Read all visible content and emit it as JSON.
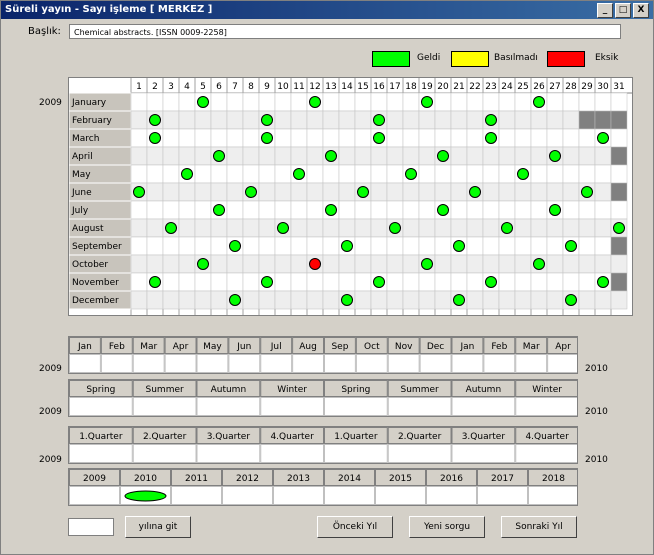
{
  "window": {
    "title": "Süreli yayın - Sayı işleme [ MERKEZ ]",
    "minimize_label": "_",
    "maximize_label": "□",
    "close_label": "X"
  },
  "baslik": {
    "label": "Başlık:",
    "value": "Chemical abstracts.  [ISSN 0009-2258]"
  },
  "legend": [
    {
      "label": "Geldi",
      "color": "#00ff00"
    },
    {
      "label": "Basılmadı",
      "color": "#ffff00"
    },
    {
      "label": "Eksik",
      "color": "#ff0000"
    }
  ],
  "calendar": {
    "year": "2009",
    "days": [
      "1",
      "2",
      "3",
      "4",
      "5",
      "6",
      "7",
      "8",
      "9",
      "10",
      "11",
      "12",
      "13",
      "14",
      "15",
      "16",
      "17",
      "18",
      "19",
      "20",
      "21",
      "22",
      "23",
      "24",
      "25",
      "26",
      "27",
      "28",
      "29",
      "30",
      "31"
    ],
    "months": [
      {
        "name": "January",
        "arrived": [
          5,
          12,
          19,
          26
        ],
        "missing": [],
        "invalid_from": 32
      },
      {
        "name": "February",
        "arrived": [
          2,
          9,
          16,
          23
        ],
        "missing": [],
        "invalid_from": 29
      },
      {
        "name": "March",
        "arrived": [
          2,
          9,
          16,
          23,
          30
        ],
        "missing": [],
        "invalid_from": 32
      },
      {
        "name": "April",
        "arrived": [
          6,
          13,
          20,
          27
        ],
        "missing": [],
        "invalid_from": 31
      },
      {
        "name": "May",
        "arrived": [
          4,
          11,
          18,
          25
        ],
        "missing": [],
        "invalid_from": 32
      },
      {
        "name": "June",
        "arrived": [
          1,
          8,
          15,
          22,
          29
        ],
        "missing": [],
        "invalid_from": 31
      },
      {
        "name": "July",
        "arrived": [
          6,
          13,
          20,
          27
        ],
        "missing": [],
        "invalid_from": 32
      },
      {
        "name": "August",
        "arrived": [
          3,
          10,
          17,
          24,
          31
        ],
        "missing": [],
        "invalid_from": 32
      },
      {
        "name": "September",
        "arrived": [
          7,
          14,
          21,
          28
        ],
        "missing": [],
        "invalid_from": 31
      },
      {
        "name": "October",
        "arrived": [
          5,
          19,
          26
        ],
        "missing": [
          12
        ],
        "invalid_from": 32
      },
      {
        "name": "November",
        "arrived": [
          2,
          9,
          16,
          23,
          30
        ],
        "missing": [],
        "invalid_from": 31
      },
      {
        "name": "December",
        "arrived": [
          7,
          14,
          21,
          28
        ],
        "missing": [],
        "invalid_from": 32
      }
    ]
  },
  "monthly": {
    "left_year": "2009",
    "right_year": "2010",
    "headers": [
      "Jan",
      "Feb",
      "Mar",
      "Apr",
      "May",
      "Jun",
      "Jul",
      "Aug",
      "Sep",
      "Oct",
      "Nov",
      "Dec",
      "Jan",
      "Feb",
      "Mar",
      "Apr"
    ]
  },
  "seasonal": {
    "left_year": "2009",
    "right_year": "2010",
    "headers": [
      "Spring",
      "Summer",
      "Autumn",
      "Winter",
      "Spring",
      "Summer",
      "Autumn",
      "Winter"
    ]
  },
  "quarterly": {
    "left_year": "2009",
    "right_year": "2010",
    "headers": [
      "1.Quarter",
      "2.Quarter",
      "3.Quarter",
      "4.Quarter",
      "1.Quarter",
      "2.Quarter",
      "3.Quarter",
      "4.Quarter"
    ]
  },
  "yearly": {
    "headers": [
      "2009",
      "2010",
      "2011",
      "2012",
      "2013",
      "2014",
      "2015",
      "2016",
      "2017",
      "2018"
    ],
    "arrived_index": 1
  },
  "buttons": {
    "goto_year": "yılına git",
    "prev_year": "Önceki Yıl",
    "new_query": "Yeni sorgu",
    "next_year": "Sonraki Yıl"
  }
}
